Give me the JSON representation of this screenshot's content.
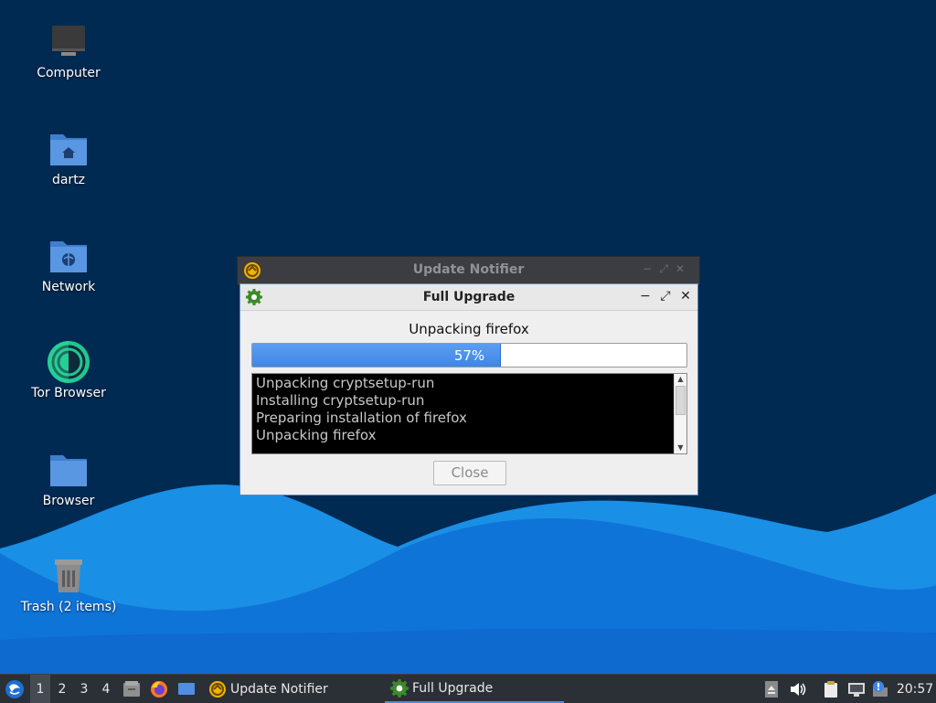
{
  "desktop": {
    "icons": [
      {
        "label": "Computer",
        "icon": "computer-icon"
      },
      {
        "label": "dartz",
        "icon": "home-folder-icon"
      },
      {
        "label": "Network",
        "icon": "network-folder-icon"
      },
      {
        "label": "Tor Browser",
        "icon": "tor-browser-icon"
      },
      {
        "label": "Browser",
        "icon": "folder-icon"
      },
      {
        "label": "Trash (2 items)",
        "icon": "trash-icon"
      }
    ]
  },
  "windows": {
    "notifier": {
      "title": "Update Notifier"
    },
    "upgrade": {
      "title": "Full Upgrade",
      "status": "Unpacking firefox",
      "progress_fraction": 0.57,
      "progress_label": "57%",
      "log": [
        "Unpacking cryptsetup-run",
        "Installing cryptsetup-run",
        "Preparing installation of firefox",
        "Unpacking firefox"
      ],
      "close_label": "Close"
    }
  },
  "taskbar": {
    "workspaces": [
      "1",
      "2",
      "3",
      "4"
    ],
    "active_workspace": "1",
    "tasks": [
      {
        "label": "Update Notifier",
        "icon": "update-notifier-icon"
      },
      {
        "label": "Full Upgrade",
        "icon": "gear-icon"
      }
    ],
    "clock": "20:57"
  },
  "colors": {
    "desktop_bg": "#002a52",
    "accent": "#4c8ae0",
    "progress": "#3f86e6"
  }
}
